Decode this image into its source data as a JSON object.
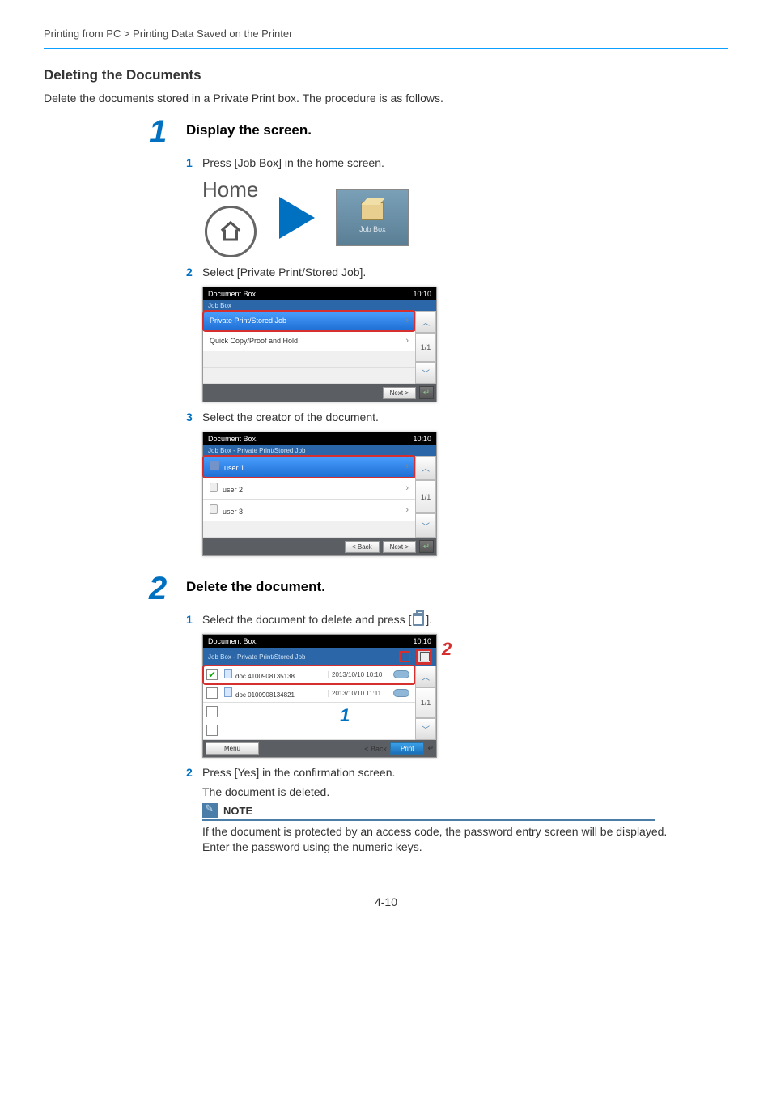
{
  "breadcrumb": "Printing from PC > Printing Data Saved on the Printer",
  "sectionTitle": "Deleting the Documents",
  "intro": "Delete the documents stored in a Private Print box. The procedure is as follows.",
  "step1": {
    "title": "Display the screen.",
    "sub1": "Press [Job Box] in the home screen.",
    "homeLabel": "Home",
    "jobBoxLabel": "Job Box",
    "sub2": "Select [Private Print/Stored Job].",
    "screenA": {
      "title": "Document Box.",
      "subtitle": "Job Box",
      "time": "10:10",
      "items": [
        "Private Print/Stored Job",
        "Quick Copy/Proof and Hold"
      ],
      "page": "1/1",
      "next": "Next >"
    },
    "sub3": "Select the creator of the document.",
    "screenB": {
      "title": "Document Box.",
      "subtitle": "Job Box - Private Print/Stored Job",
      "time": "10:10",
      "users": [
        "user 1",
        "user 2",
        "user 3"
      ],
      "page": "1/1",
      "back": "< Back",
      "next": "Next >"
    }
  },
  "step2": {
    "title": "Delete the document.",
    "sub1_pre": "Select the document to delete and press [",
    "sub1_post": "].",
    "screenC": {
      "title": "Document Box.",
      "subtitle": "Job Box - Private Print/Stored Job",
      "time": "10:10",
      "docs": [
        {
          "name": "doc 4100908135138",
          "date": "2013/10/10 10:10",
          "checked": true
        },
        {
          "name": "doc 0100908134821",
          "date": "2013/10/10 11:11",
          "checked": false
        }
      ],
      "page": "1/1",
      "menu": "Menu",
      "back": "< Back",
      "print": "Print"
    },
    "sub2": "Press [Yes] in the confirmation screen.",
    "result": "The document is deleted."
  },
  "note": {
    "label": "NOTE",
    "text": "If the document is protected by an access code, the password entry screen will be displayed. Enter the password using the numeric keys."
  },
  "pageNumber": "4-10",
  "callouts": {
    "c1": "1",
    "c2": "2"
  }
}
